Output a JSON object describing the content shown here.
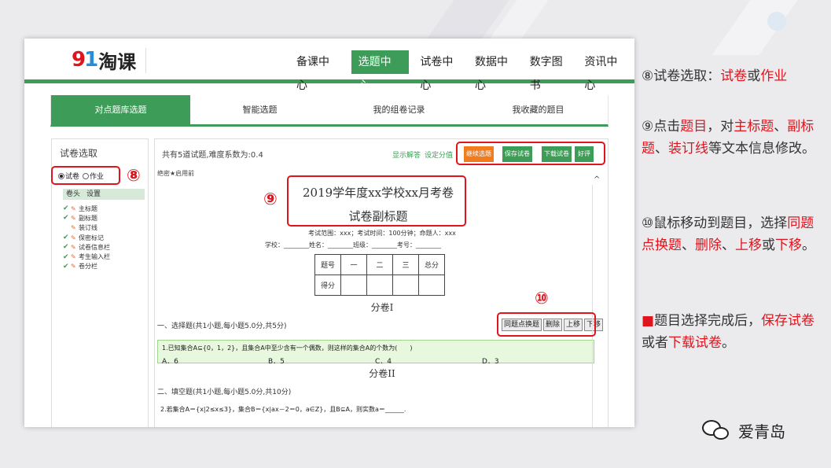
{
  "colors": {
    "brand_green": "#3d9c57",
    "accent_orange": "#f07c1d",
    "callout_red": "#e0141c"
  },
  "logo": {
    "mark": "91",
    "text": "淘课"
  },
  "nav": [
    "备课中心",
    "选题中心",
    "试卷中心",
    "数据中心",
    "数字图书",
    "资讯中心"
  ],
  "nav_active_index": 1,
  "tabs": [
    "对点题库选题",
    "智能选题",
    "我的组卷记录",
    "我收藏的题目"
  ],
  "left": {
    "title": "试卷选取",
    "radios": [
      {
        "label": "试卷",
        "checked": true
      },
      {
        "label": "作业",
        "checked": false
      }
    ],
    "header": [
      "卷头",
      "设置"
    ],
    "items": [
      {
        "label": "主标题",
        "checked": true
      },
      {
        "label": "副标题",
        "checked": true
      },
      {
        "label": "装订线",
        "checked": false
      },
      {
        "label": "保密标记",
        "checked": true
      },
      {
        "label": "试卷信息栏",
        "checked": true
      },
      {
        "label": "考生输入栏",
        "checked": true
      },
      {
        "label": "卷分栏",
        "checked": true
      }
    ]
  },
  "main": {
    "info": "共有5道试题,难度系数为:0.4",
    "links": [
      "显示解答",
      "设定分值"
    ],
    "buttons": [
      "继续选题",
      "保存试卷",
      "下载试卷",
      "好评"
    ],
    "secret": "绝密★启用前",
    "title": "2019学年度xx学校xx月考卷",
    "subtitle": "试卷副标题",
    "exam_info": "考试范围：xxx；考试时间：100分钟；命题人：xxx",
    "fill_row": "学校：________姓名：________班级：________考号：________",
    "score_table": [
      [
        "题号",
        "一",
        "二",
        "三",
        "总分"
      ],
      [
        "得分",
        "",
        "",
        "",
        ""
      ]
    ],
    "part1": "分卷I",
    "section1": "一、选择题(共1小题,每小题5.0分,共5分)",
    "question_buttons": [
      "同题点换题",
      "删除",
      "上移",
      "下移"
    ],
    "q1": "1.已知集合A⊆{0，1，2}，且集合A中至少含有一个偶数，则这样的集合A的个数为(　　)",
    "options": [
      "A．6",
      "B．5",
      "C．4",
      "D．3"
    ],
    "part2": "分卷II",
    "section2": "二、填空题(共1小题,每小题5.0分,共10分)",
    "q2": "2.若集合A＝{x|2≤x≤3}，集合B＝{x|ax－2＝0，a∈Z}，且B⊆A，则实数a＝______."
  },
  "badges": [
    "⑧",
    "⑨",
    "⑩"
  ],
  "notes": {
    "n8": {
      "prefix": "⑧试卷选取：",
      "a": "试卷",
      "or": "或",
      "b": "作业"
    },
    "n9": {
      "prefix": "⑨点击",
      "a": "题目",
      "t1": "，对",
      "b": "主标题",
      "t2": "、",
      "c": "副标题",
      "t3": "、",
      "d": "装订线",
      "t4": "等文本信息修改。"
    },
    "n10": {
      "prefix": "⑩鼠标移动到题目，选择",
      "a": "同题点换题",
      "t1": "、",
      "b": "删除",
      "t2": "、",
      "c": "上移",
      "t3": "或",
      "d": "下移",
      "t4": "。"
    },
    "n11": {
      "square": "■",
      "prefix": "题目选择完成后，",
      "a": "保存试卷",
      "t1": "或者",
      "b": "下载试卷",
      "t2": "。"
    }
  },
  "watermark": "爱青岛"
}
